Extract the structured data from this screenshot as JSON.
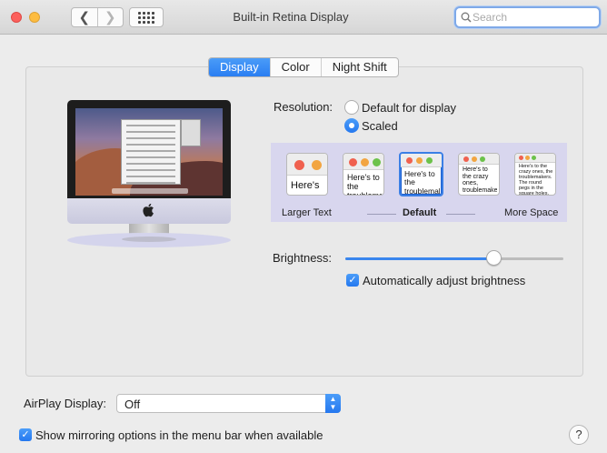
{
  "window": {
    "title": "Built-in Retina Display",
    "search_placeholder": "Search",
    "back_glyph": "❮",
    "forward_glyph": "❯"
  },
  "tabs": [
    {
      "label": "Display",
      "selected": true
    },
    {
      "label": "Color",
      "selected": false
    },
    {
      "label": "Night Shift",
      "selected": false
    }
  ],
  "resolution": {
    "label": "Resolution:",
    "options": [
      {
        "label": "Default for display",
        "selected": false
      },
      {
        "label": "Scaled",
        "selected": true
      }
    ],
    "scale_thumbnails": [
      {
        "text": "Here's",
        "selected": false
      },
      {
        "text": "Here's to the troublemakers",
        "selected": false
      },
      {
        "text": "Here's to the troublemakers, the ones who",
        "selected": true
      },
      {
        "text": "Here's to the crazy ones, troublemakers. The ones who see things",
        "selected": false
      },
      {
        "text": "Here's to the crazy ones, the troublemakers. The round pegs in the square holes. The ones who see things differently.",
        "selected": false
      }
    ],
    "scale_labels": {
      "larger": "Larger Text",
      "default": "Default",
      "more": "More Space"
    }
  },
  "brightness": {
    "label": "Brightness:",
    "value": 0.68,
    "auto_label": "Automatically adjust brightness",
    "auto_checked": true
  },
  "airplay": {
    "label": "AirPlay Display:",
    "value": "Off"
  },
  "mirroring": {
    "label": "Show mirroring options in the menu bar when available",
    "checked": true
  },
  "help_label": "?",
  "colors": {
    "accent": "#2a7ef2",
    "close": "#fc605c",
    "minimize": "#fdbc40",
    "scale_strip": "#d8d6ee"
  },
  "icons": [
    "close-button-icon",
    "minimize-button-icon",
    "chevron-left-icon",
    "chevron-right-icon",
    "grid-icon",
    "search-icon",
    "apple-logo-icon",
    "checkmark-icon",
    "updown-arrows-icon"
  ]
}
